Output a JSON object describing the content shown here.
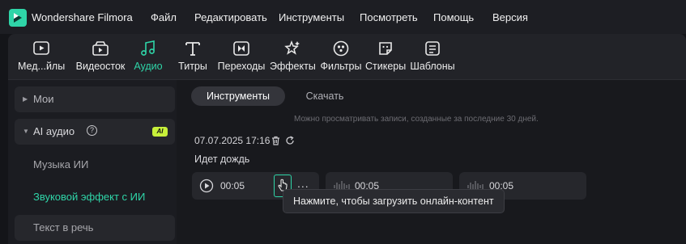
{
  "app": {
    "title": "Wondershare Filmora"
  },
  "menu": [
    "Файл",
    "Редактировать",
    "Инструменты",
    "Посмотреть",
    "Помощь",
    "Версия"
  ],
  "toolbar": {
    "items": [
      {
        "label": "Мед...йлы",
        "icon": "media-icon"
      },
      {
        "label": "Видеосток",
        "icon": "stock-video-icon"
      },
      {
        "label": "Аудио",
        "icon": "audio-icon",
        "active": true
      },
      {
        "label": "Титры",
        "icon": "titles-icon"
      },
      {
        "label": "Переходы",
        "icon": "transitions-icon"
      },
      {
        "label": "Эффекты",
        "icon": "effects-icon"
      },
      {
        "label": "Фильтры",
        "icon": "filters-icon"
      },
      {
        "label": "Стикеры",
        "icon": "stickers-icon"
      },
      {
        "label": "Шаблоны",
        "icon": "templates-icon"
      }
    ]
  },
  "sidebar": {
    "mine": "Мои",
    "ai_audio": "AI аудио",
    "ai_badge": "AI",
    "music_ai": "Музыка ИИ",
    "sound_effect_ai": "Звуковой эффект с ИИ",
    "text_to_speech": "Текст в речь"
  },
  "tabs": {
    "tools": "Инструменты",
    "download": "Скачать"
  },
  "notice": "Можно просматривать записи, созданные за последние 30 дней.",
  "record": {
    "date": "07.07.2025 17:16",
    "title": "Идет дождь",
    "clips": [
      {
        "time": "00:05"
      },
      {
        "time": "00:05"
      },
      {
        "time": "00:05"
      }
    ],
    "more": "..."
  },
  "tooltip": "Нажмите, чтобы загрузить онлайн-контент",
  "colors": {
    "accent": "#2fd5a8",
    "ai_badge": "#c7f03a",
    "background": "#141519"
  }
}
